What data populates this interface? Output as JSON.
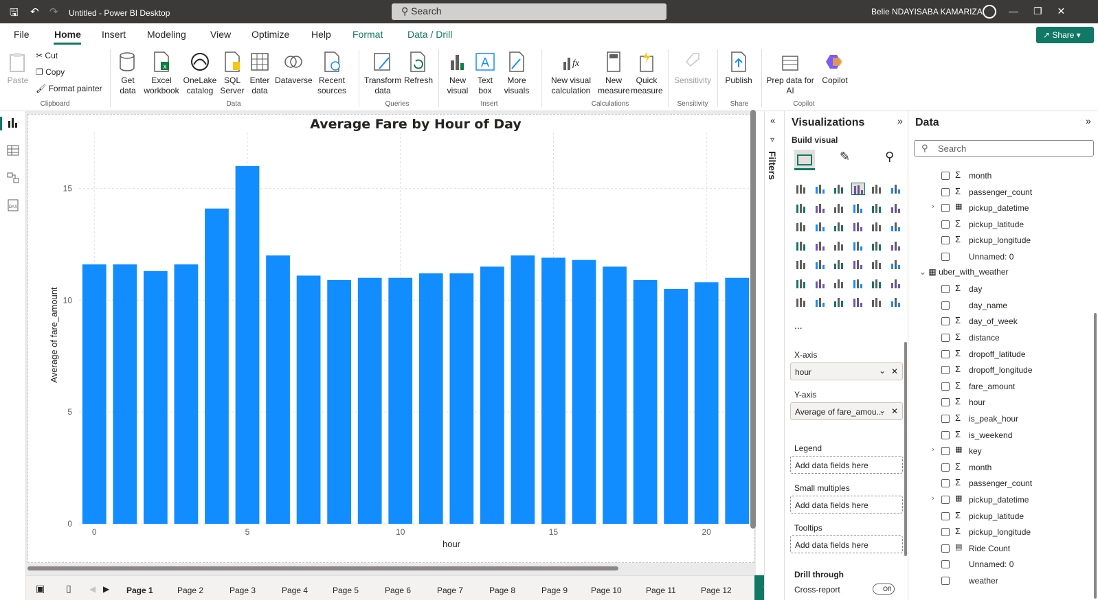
{
  "titlebar": {
    "app_title": "Untitled - Power BI Desktop",
    "search_placeholder": "Search",
    "user_name": "Belie NDAYISABA KAMARIZA"
  },
  "menu": {
    "items": [
      "File",
      "Home",
      "Insert",
      "Modeling",
      "View",
      "Optimize",
      "Help",
      "Format",
      "Data / Drill"
    ],
    "active": "Home",
    "share": "Share"
  },
  "ribbon": {
    "paste": "Paste",
    "cut": "Cut",
    "copy": "Copy",
    "format_painter": "Format painter",
    "clipboard": "Clipboard",
    "get_data": "Get data",
    "excel": "Excel workbook",
    "onelake": "OneLake catalog",
    "sql": "SQL Server",
    "enter": "Enter data",
    "dataverse": "Dataverse",
    "recent": "Recent sources",
    "data_group": "Data",
    "transform": "Transform data",
    "refresh": "Refresh",
    "queries": "Queries",
    "new_visual": "New visual",
    "text_box": "Text box",
    "more_visuals": "More visuals",
    "insert": "Insert",
    "new_visual_calc": "New visual calculation",
    "new_measure": "New measure",
    "quick_measure": "Quick measure",
    "calculations": "Calculations",
    "sensitivity": "Sensitivity",
    "sensitivity_group": "Sensitivity",
    "publish": "Publish",
    "share_group": "Share",
    "prep_data": "Prep data for AI",
    "copilot": "Copilot",
    "copilot_group": "Copilot"
  },
  "chart_data": {
    "type": "bar",
    "title": "Average Fare by Hour of Day",
    "xlabel": "hour",
    "ylabel": "Average of fare_amount",
    "x": [
      0,
      1,
      2,
      3,
      4,
      5,
      6,
      7,
      8,
      9,
      10,
      11,
      12,
      13,
      14,
      15,
      16,
      17,
      18,
      19,
      20,
      21
    ],
    "values": [
      11.6,
      11.6,
      11.3,
      11.6,
      14.1,
      16.0,
      12.0,
      11.1,
      10.9,
      11.0,
      11.0,
      11.2,
      11.2,
      11.5,
      12.0,
      11.9,
      11.8,
      11.5,
      10.9,
      10.5,
      10.8,
      11.0
    ],
    "xticks": [
      0,
      5,
      10,
      15,
      20
    ],
    "yticks": [
      0,
      5,
      10,
      15
    ],
    "ylim": [
      0,
      17.5
    ],
    "bar_color": "#118dff",
    "grid": true
  },
  "pages": [
    "Page 1",
    "Page 2",
    "Page 3",
    "Page 4",
    "Page 5",
    "Page 6",
    "Page 7",
    "Page 8",
    "Page 9",
    "Page 10",
    "Page 11",
    "Page 12"
  ],
  "filters": {
    "label": "Filters"
  },
  "viz": {
    "title": "Visualizations",
    "build": "Build visual",
    "more": "...",
    "wells": [
      {
        "label": "X-axis",
        "value": "hour",
        "filled": true
      },
      {
        "label": "Y-axis",
        "value": "Average of fare_amou...",
        "filled": true
      },
      {
        "label": "Legend",
        "value": "Add data fields here",
        "filled": false
      },
      {
        "label": "Small multiples",
        "value": "Add data fields here",
        "filled": false
      },
      {
        "label": "Tooltips",
        "value": "Add data fields here",
        "filled": false
      }
    ],
    "drill_through": "Drill through",
    "cross_report": "Cross-report",
    "toggle": "Off"
  },
  "data": {
    "title": "Data",
    "search_placeholder": "Search",
    "table_name": "uber_with_weather",
    "fields_top": [
      {
        "name": "month",
        "type": "sigma"
      },
      {
        "name": "passenger_count",
        "type": "sigma"
      },
      {
        "name": "pickup_datetime",
        "type": "calendar",
        "expand": true
      },
      {
        "name": "pickup_latitude",
        "type": "sigma"
      },
      {
        "name": "pickup_longitude",
        "type": "sigma"
      },
      {
        "name": "Unnamed: 0",
        "type": "none"
      }
    ],
    "fields": [
      {
        "name": "day",
        "type": "sigma"
      },
      {
        "name": "day_name",
        "type": "none"
      },
      {
        "name": "day_of_week",
        "type": "sigma"
      },
      {
        "name": "distance",
        "type": "sigma"
      },
      {
        "name": "dropoff_latitude",
        "type": "sigma"
      },
      {
        "name": "dropoff_longitude",
        "type": "sigma"
      },
      {
        "name": "fare_amount",
        "type": "sigma"
      },
      {
        "name": "hour",
        "type": "sigma"
      },
      {
        "name": "is_peak_hour",
        "type": "sigma"
      },
      {
        "name": "is_weekend",
        "type": "sigma"
      },
      {
        "name": "key",
        "type": "calendar",
        "expand": true
      },
      {
        "name": "month",
        "type": "sigma"
      },
      {
        "name": "passenger_count",
        "type": "sigma"
      },
      {
        "name": "pickup_datetime",
        "type": "calendar",
        "expand": true
      },
      {
        "name": "pickup_latitude",
        "type": "sigma"
      },
      {
        "name": "pickup_longitude",
        "type": "sigma"
      },
      {
        "name": "Ride Count",
        "type": "calc"
      },
      {
        "name": "Unnamed: 0",
        "type": "none"
      },
      {
        "name": "weather",
        "type": "none"
      }
    ]
  }
}
